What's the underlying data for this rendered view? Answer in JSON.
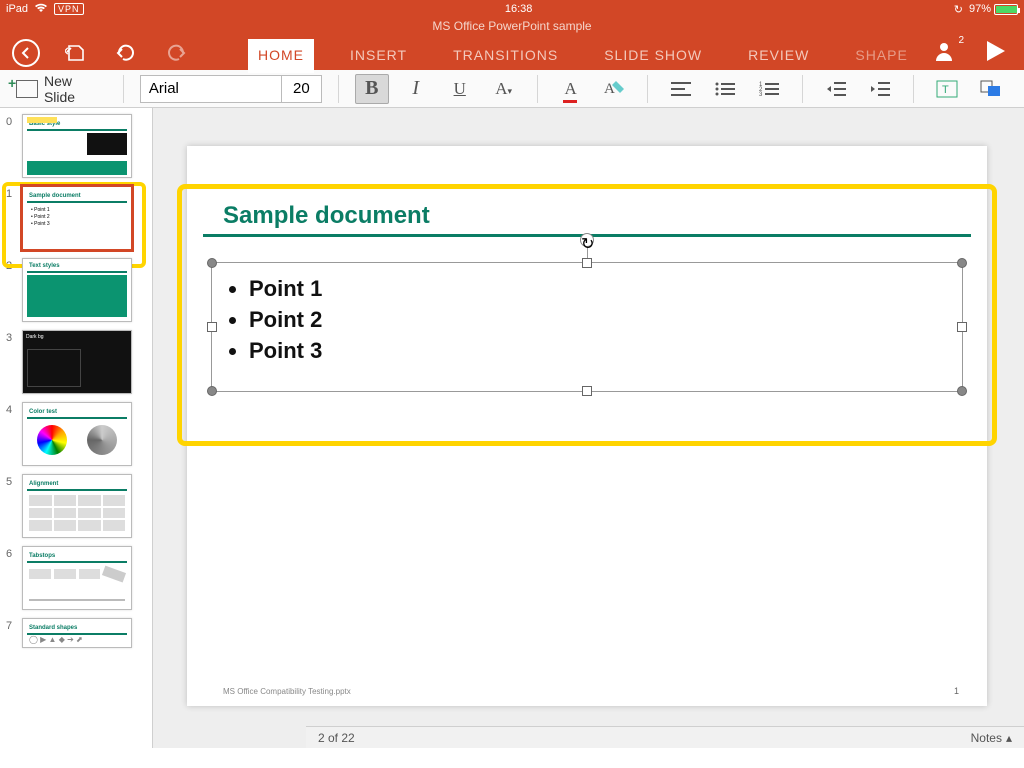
{
  "status": {
    "device": "iPad",
    "vpn": "VPN",
    "time": "16:38",
    "battery_pct": "97%"
  },
  "doc": {
    "title": "MS Office PowerPoint sample",
    "footer": "MS Office Compatibility Testing.pptx",
    "current_slide_footer_num": "1"
  },
  "tabs": {
    "home": "HOME",
    "insert": "INSERT",
    "transitions": "TRANSITIONS",
    "slideshow": "SLIDE SHOW",
    "review": "REVIEW",
    "shape": "SHAPE"
  },
  "user_badge": "2",
  "ribbon": {
    "new_slide": "New Slide",
    "font_name": "Arial",
    "font_size": "20"
  },
  "thumbs": {
    "indices": [
      "0",
      "1",
      "2",
      "3",
      "4",
      "5",
      "6",
      "7"
    ],
    "selected_index": 1
  },
  "slide": {
    "title": "Sample document",
    "bullets": [
      "Point 1",
      "Point 2",
      "Point 3"
    ]
  },
  "bottom": {
    "counter": "2 of 22",
    "notes": "Notes"
  }
}
